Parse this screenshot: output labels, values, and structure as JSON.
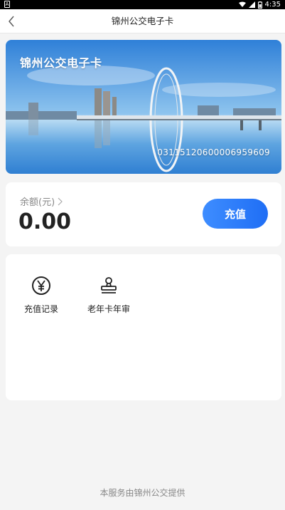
{
  "status_bar": {
    "time": "4:35"
  },
  "nav": {
    "title": "锦州公交电子卡"
  },
  "card": {
    "title": "锦州公交电子卡",
    "number": "03115120600006959609"
  },
  "balance": {
    "label": "余额(元)",
    "amount": "0.00",
    "recharge_label": "充值"
  },
  "services": [
    {
      "label": "充值记录",
      "icon": "yen-circle-icon"
    },
    {
      "label": "老年卡年审",
      "icon": "stamp-icon"
    }
  ],
  "footer": {
    "text": "本服务由锦州公交提供"
  },
  "colors": {
    "accent": "#1f6ef5",
    "page_bg": "#f4f4f4"
  }
}
